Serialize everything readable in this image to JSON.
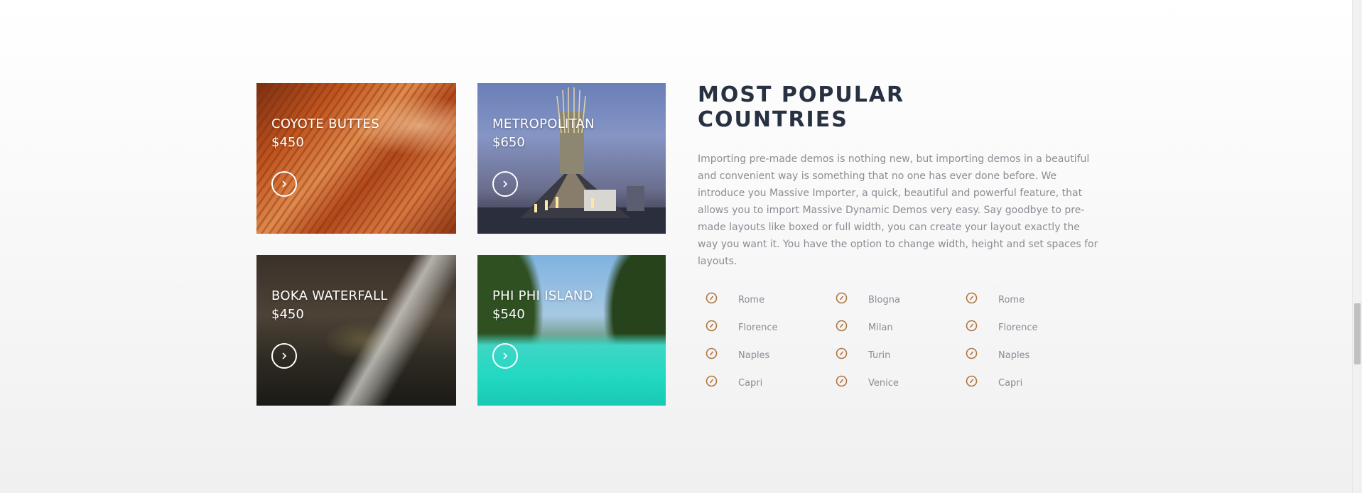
{
  "cards": [
    {
      "title": "COYOTE BUTTES",
      "price": "$450"
    },
    {
      "title": "METROPOLITAN",
      "price": "$650"
    },
    {
      "title": "BOKA WATERFALL",
      "price": "$450"
    },
    {
      "title": "PHI PHI ISLAND",
      "price": "$540"
    }
  ],
  "section": {
    "heading_line1": "MOST POPULAR",
    "heading_line2": "COUNTRIES",
    "description": "Importing pre-made demos is nothing new, but importing demos in a beautiful and convenient way is something that no one has ever done before. We introduce you Massive Importer, a quick, beautiful and powerful feature, that allows you to import Massive Dynamic Demos very easy. Say goodbye to pre-made layouts like boxed or full width, you can create your layout exactly the way you want it. You have the option to change width, height and set spaces for layouts."
  },
  "lists": [
    [
      "Rome",
      "Florence",
      "Naples",
      "Capri"
    ],
    [
      "Blogna",
      "Milan",
      "Turin",
      "Venice"
    ],
    [
      "Rome",
      "Florence",
      "Naples",
      "Capri"
    ]
  ],
  "icons": {
    "card_button": "chevron-right-icon",
    "list_bullet": "check-circle-icon"
  },
  "colors": {
    "accent": "#b0763f",
    "heading": "#283142",
    "body_text": "#8a8d93"
  }
}
